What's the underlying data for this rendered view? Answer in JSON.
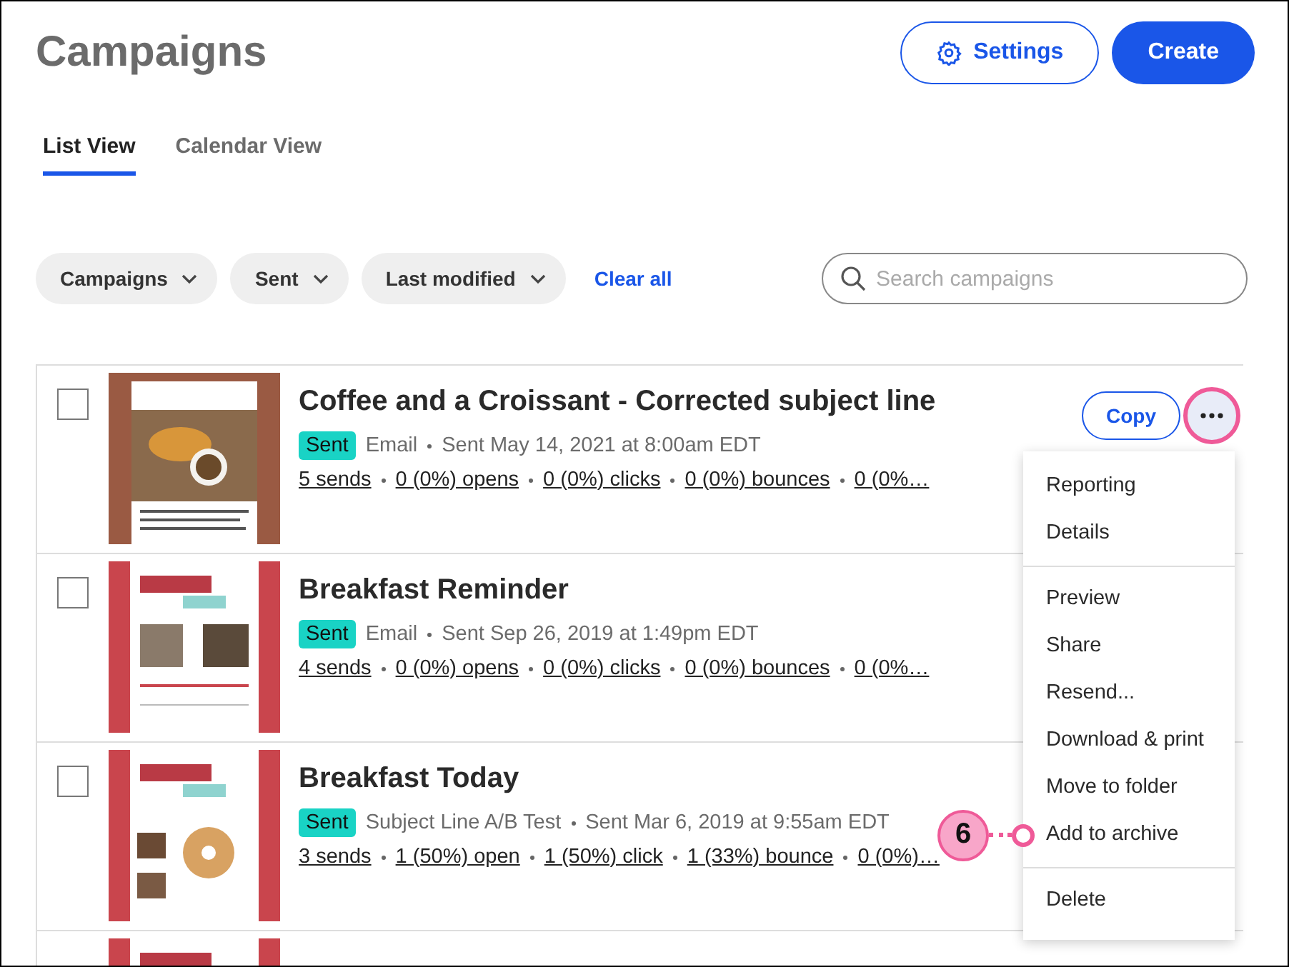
{
  "header": {
    "title": "Campaigns",
    "settings_button": "Settings",
    "create_button": "Create"
  },
  "tabs": [
    {
      "label": "List View",
      "selected": true
    },
    {
      "label": "Calendar View",
      "selected": false
    }
  ],
  "filters": [
    {
      "label": "Campaigns"
    },
    {
      "label": "Sent"
    },
    {
      "label": "Last modified"
    }
  ],
  "clear_all": "Clear all",
  "search": {
    "placeholder": "Search campaigns"
  },
  "rows": [
    {
      "kind": "croissant",
      "checked": false,
      "title": "Coffee and a Croissant - Corrected subject line",
      "status": "Sent",
      "type": "Email",
      "sent": "Sent May 14, 2021 at 8:00am EDT",
      "stats": [
        "5 sends",
        "0 (0%) opens",
        "0 (0%) clicks",
        "0 (0%) bounces",
        "0 (0%…"
      ],
      "copy_button": "Copy",
      "menu_open": true
    },
    {
      "kind": "brickyard",
      "checked": false,
      "title": "Breakfast Reminder",
      "status": "Sent",
      "type": "Email",
      "sent": "Sent Sep 26, 2019 at 1:49pm EDT",
      "stats": [
        "4 sends",
        "0 (0%) opens",
        "0 (0%) clicks",
        "0 (0%) bounces",
        "0 (0%…"
      ],
      "menu_open": false
    },
    {
      "kind": "bagel",
      "checked": false,
      "title": "Breakfast Today",
      "status": "Sent",
      "type": "Subject Line A/B Test",
      "sent": "Sent Mar 6, 2019 at 9:55am EDT",
      "stats": [
        "3 sends",
        "1 (50%) open",
        "1 (50%) click",
        "1 (33%) bounce",
        "0 (0%)…"
      ],
      "menu_open": false
    },
    {
      "kind": "brickyard"
    }
  ],
  "menu": [
    [
      {
        "label": "Reporting"
      },
      {
        "label": "Details"
      }
    ],
    [
      {
        "label": "Preview"
      },
      {
        "label": "Share"
      },
      {
        "label": "Resend..."
      },
      {
        "label": "Download & print"
      },
      {
        "label": "Move to folder"
      },
      {
        "label": "Add to archive",
        "callout": "6"
      }
    ],
    [
      {
        "label": "Delete"
      }
    ]
  ]
}
